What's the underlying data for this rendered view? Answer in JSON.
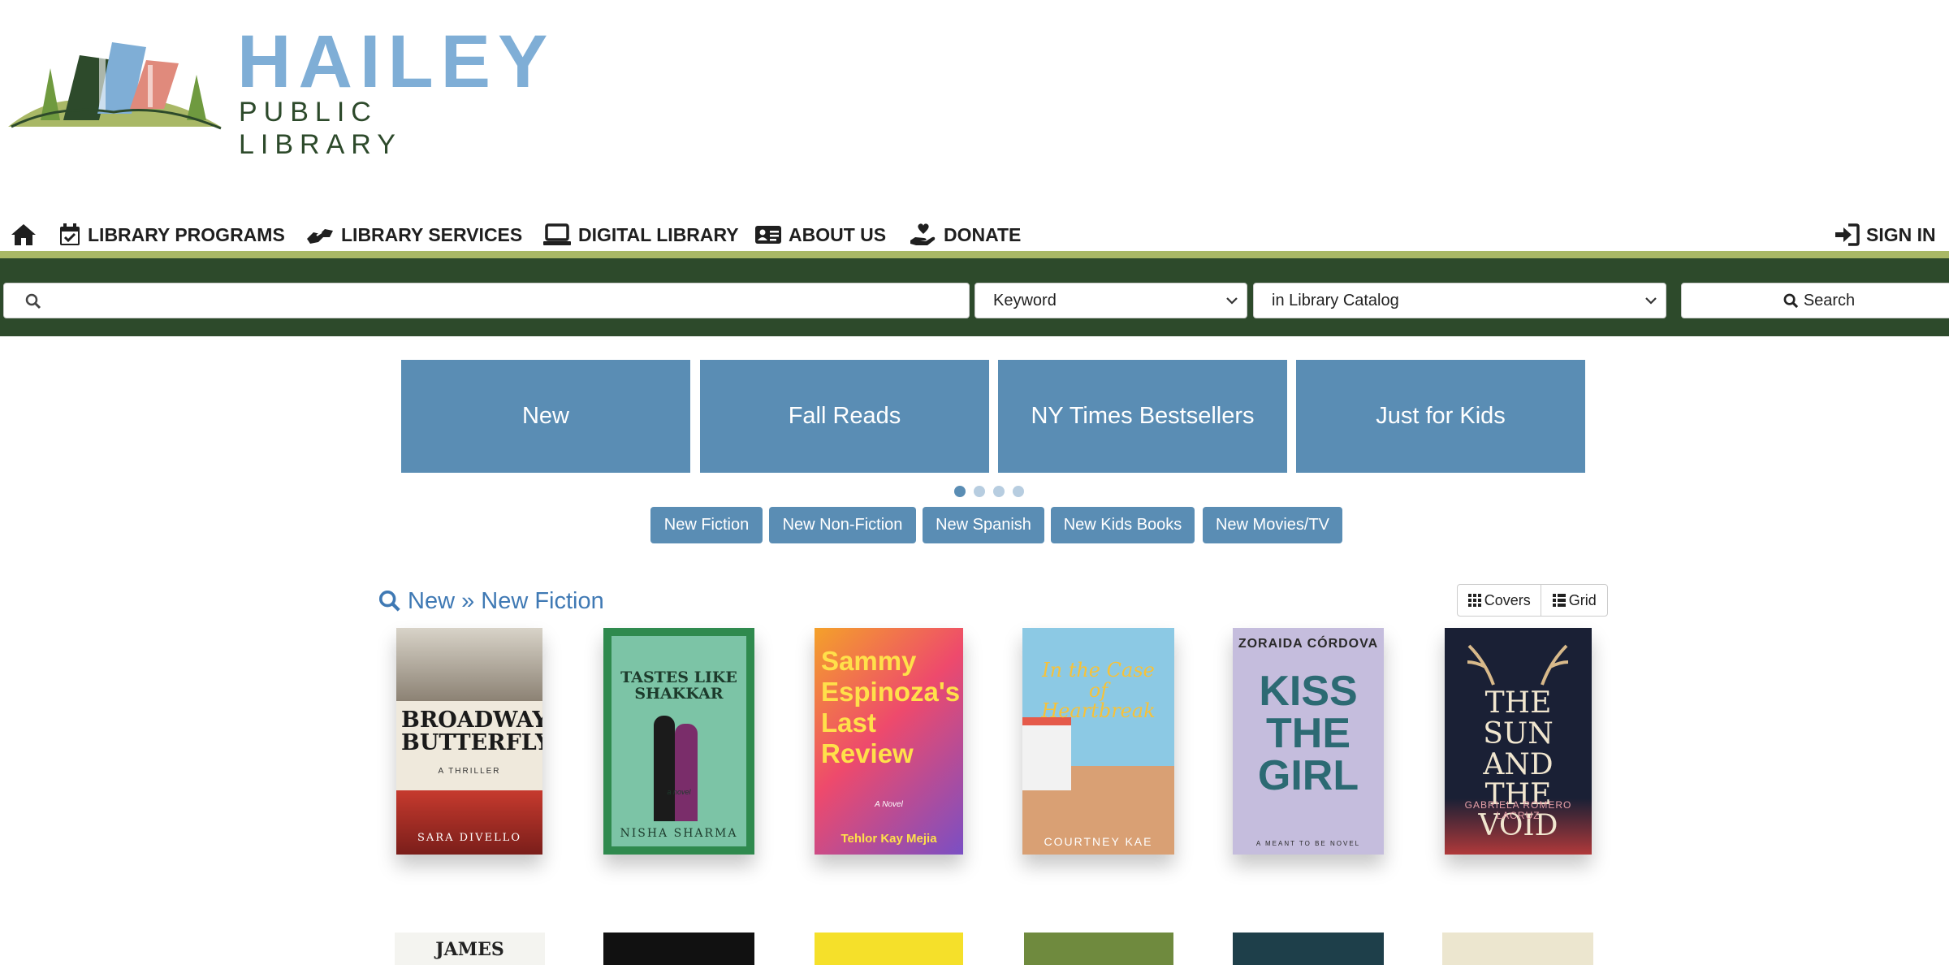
{
  "logo": {
    "line1": "HAILEY",
    "line2": "PUBLIC LIBRARY"
  },
  "nav": {
    "home_icon": "home-icon",
    "items": [
      {
        "label": "LIBRARY PROGRAMS",
        "icon": "calendar-check-icon"
      },
      {
        "label": "LIBRARY SERVICES",
        "icon": "hands-helping-icon"
      },
      {
        "label": "DIGITAL LIBRARY",
        "icon": "laptop-icon"
      },
      {
        "label": "ABOUT US",
        "icon": "id-card-icon"
      },
      {
        "label": "DONATE",
        "icon": "hand-holding-heart-icon"
      }
    ],
    "sign_in": "SIGN IN"
  },
  "search": {
    "value": "",
    "type_selected": "Keyword",
    "scope_selected": "in Library Catalog",
    "button_label": "Search"
  },
  "carousel": {
    "tiles": [
      "New",
      "Fall Reads",
      "NY Times Bestsellers",
      "Just for Kids"
    ],
    "active_dot": 1,
    "dot_count": 4
  },
  "sub_buttons": [
    "New Fiction",
    "New Non-Fiction",
    "New Spanish",
    "New Kids Books",
    "New Movies/TV"
  ],
  "results": {
    "title": "New » New Fiction",
    "view_covers": "Covers",
    "view_grid": "Grid"
  },
  "books": [
    {
      "title": "BROADWAY BUTTERFLY",
      "subtitle": "A THRILLER",
      "author": "SARA DIVELLO"
    },
    {
      "title": "TASTES LIKE SHAKKAR",
      "subtitle": "a novel",
      "author": "NISHA SHARMA"
    },
    {
      "title": "Sammy Espinoza's Last Review",
      "subtitle": "A Novel",
      "author": "Tehlor Kay Mejia"
    },
    {
      "title": "In the Case of Heartbreak",
      "subtitle": "",
      "author": "COURTNEY KAE"
    },
    {
      "title": "KISS THE GIRL",
      "subtitle": "A MEANT TO BE NOVEL",
      "author": "ZORAIDA CÓRDOVA"
    },
    {
      "title": "THE SUN AND THE VOID",
      "subtitle": "",
      "author": "GABRIELA ROMERO LACRUZ"
    }
  ],
  "colors": {
    "brand_blue": "#5a8db4",
    "dark_green": "#2d4a2b",
    "light_green": "#a9b866",
    "link_blue": "#3f79b4"
  }
}
